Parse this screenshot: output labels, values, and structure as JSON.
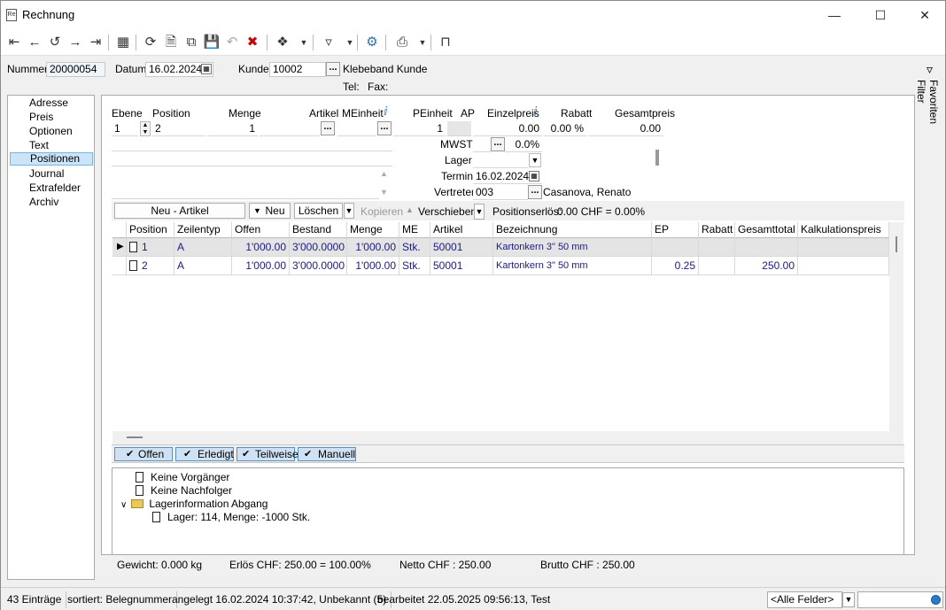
{
  "window": {
    "title": "Rechnung",
    "icon_text": "Re"
  },
  "header": {
    "nummer_label": "Nummer",
    "nummer": "20000054",
    "datum_label": "Datum",
    "datum": "16.02.2024",
    "kunde_label": "Kunde",
    "kunde": "10002",
    "kunde_name": "Klebeband Kunde",
    "tel_label": "Tel:",
    "fax_label": "Fax:"
  },
  "nav": {
    "items": [
      "Adresse",
      "Preis",
      "Optionen",
      "Text",
      "Positionen",
      "Journal",
      "Extrafelder",
      "Archiv"
    ],
    "selected": "Positionen"
  },
  "side": {
    "label": "Favoriten Filter"
  },
  "edit": {
    "labels": {
      "ebene": "Ebene",
      "position": "Position",
      "menge": "Menge",
      "artikel": "Artikel",
      "meinheit": "MEinheit",
      "peinheit": "PEinheit",
      "ap": "AP",
      "einzelpreis": "Einzelpreis",
      "rabatt": "Rabatt",
      "gesamtpreis": "Gesamtpreis"
    },
    "values": {
      "ebene": "1",
      "position": "2",
      "menge": "1",
      "peinheit": "1",
      "einzelpreis": "0.00",
      "rabatt": "0.00 %",
      "gesamtpreis": "0.00"
    },
    "mwst_label": "MWST",
    "mwst": "0.0%",
    "lager_label": "Lager",
    "termin_label": "Termin",
    "termin": "16.02.2024",
    "vertreter_label": "Vertreter",
    "vertreter": "003",
    "vertreter_name": "Casanova, Renato"
  },
  "actions": {
    "neu_artikel": "Neu - Artikel",
    "neu": "Neu",
    "loeschen": "Löschen",
    "kopieren": "Kopieren",
    "verschieben": "Verschieben",
    "positionserloes_label": "Positionserlös:",
    "positionserloes": "0.00 CHF = 0.00%"
  },
  "grid": {
    "columns": [
      "Position",
      "Zeilentyp",
      "Offen",
      "Bestand",
      "Menge",
      "ME",
      "Artikel",
      "Bezeichnung",
      "EP",
      "Rabatt",
      "Gesamttotal",
      "Kalkulationspreis"
    ],
    "rows": [
      {
        "position": "1",
        "zeilentyp": "A",
        "offen": "1'000.00",
        "bestand": "3'000.0000",
        "menge": "1'000.00",
        "me": "Stk.",
        "artikel": "50001",
        "bezeichnung": "Kartonkern 3\" 50 mm",
        "ep": "",
        "rabatt": "",
        "gesamttotal": "",
        "kalk": ""
      },
      {
        "position": "2",
        "zeilentyp": "A",
        "offen": "1'000.00",
        "bestand": "3'000.0000",
        "menge": "1'000.00",
        "me": "Stk.",
        "artikel": "50001",
        "bezeichnung": "Kartonkern 3\" 50 mm",
        "ep": "0.25",
        "rabatt": "",
        "gesamttotal": "250.00",
        "kalk": ""
      }
    ]
  },
  "filters": [
    "Offen",
    "Erledigt",
    "Teilweise",
    "Manuell"
  ],
  "tree": {
    "vorgaenger": "Keine Vorgänger",
    "nachfolger": "Keine Nachfolger",
    "lager": "Lagerinformation Abgang",
    "lager_detail": "Lager: 114, Menge: -1000 Stk."
  },
  "totals": {
    "gewicht": "Gewicht:  0.000 kg",
    "erloes": "Erlös CHF: 250.00 = 100.00%",
    "netto": "Netto CHF : 250.00",
    "brutto": "Brutto CHF : 250.00"
  },
  "status": {
    "eintraege": "43 Einträge",
    "sortiert": "sortiert: Belegnummer",
    "angelegt": "angelegt 16.02.2024 10:37:42, Unbekannt (5)",
    "bearbeitet": "bearbeitet 22.05.2025 09:56:13, Test",
    "felder": "<Alle Felder>"
  }
}
